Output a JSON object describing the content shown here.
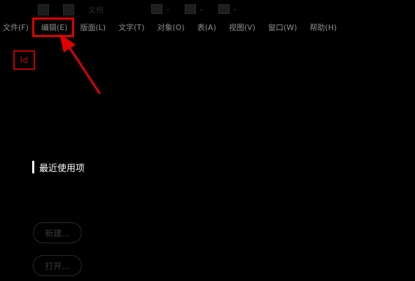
{
  "toolbar": {
    "faint_label": "文档"
  },
  "menubar": {
    "items": [
      {
        "label": "文件(F)"
      },
      {
        "label": "编辑(E)"
      },
      {
        "label": "版面(L)"
      },
      {
        "label": "文字(T)"
      },
      {
        "label": "对象(O)"
      },
      {
        "label": "表(A)"
      },
      {
        "label": "视图(V)"
      },
      {
        "label": "窗口(W)"
      },
      {
        "label": "帮助(H)"
      }
    ]
  },
  "logo": {
    "text": "Id"
  },
  "home": {
    "recent_heading": "最近使用项",
    "new_label": "新建...",
    "open_label": "打开..."
  },
  "colors": {
    "background": "#000000",
    "annotation_red": "#e00000",
    "logo_red": "#c00000",
    "heading_white": "#ffffff"
  },
  "annotation": {
    "highlighted_menu_item": "编辑(E)"
  }
}
